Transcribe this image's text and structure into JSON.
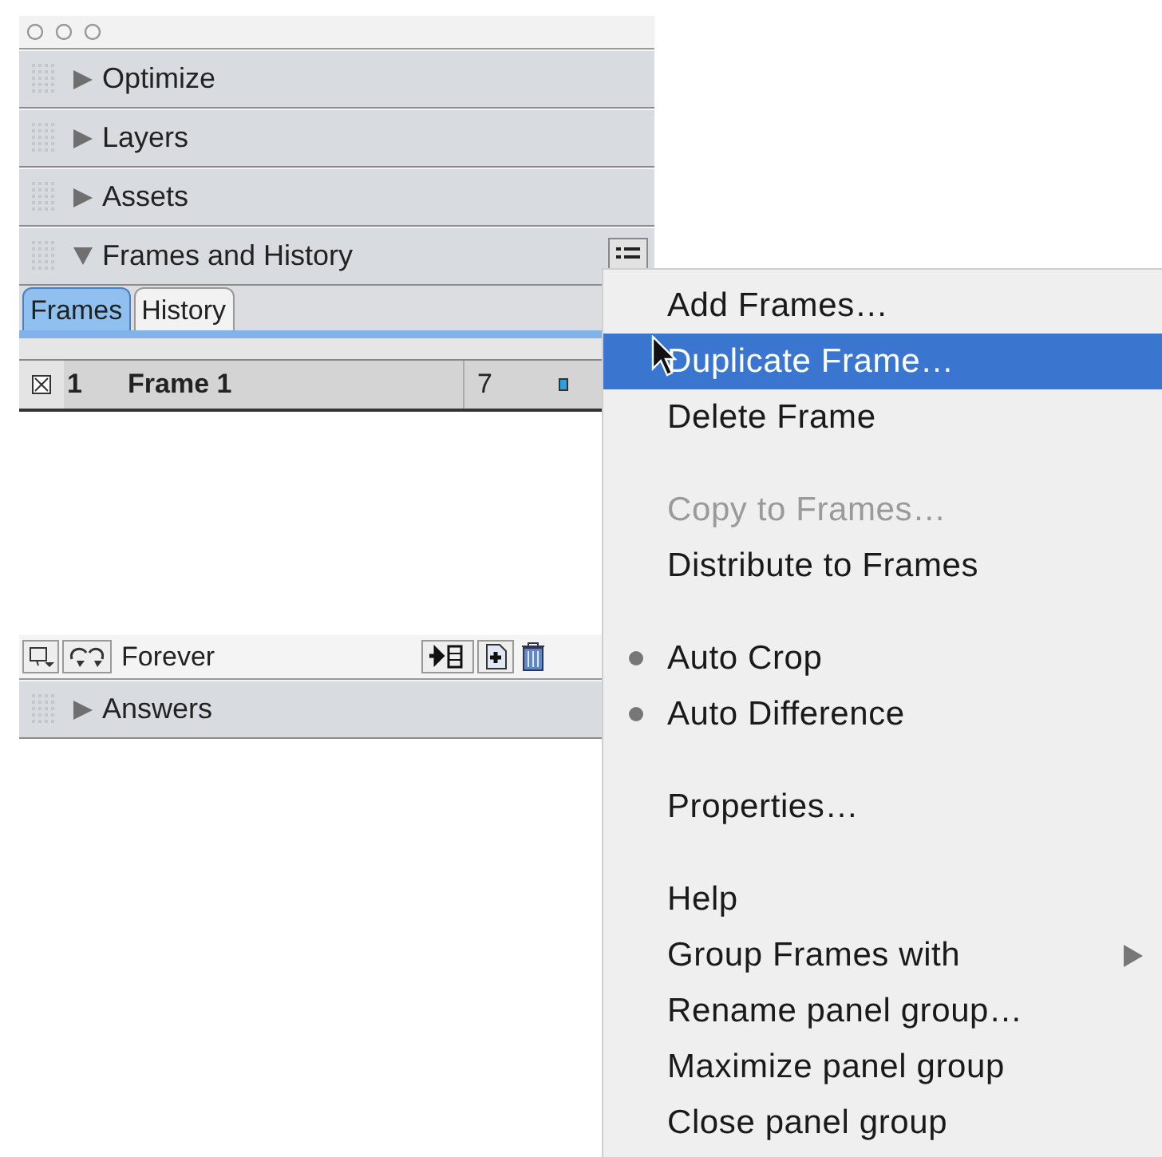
{
  "panels": [
    {
      "title": "Optimize",
      "expanded": false
    },
    {
      "title": "Layers",
      "expanded": false
    },
    {
      "title": "Assets",
      "expanded": false
    },
    {
      "title": "Frames and History",
      "expanded": true
    },
    {
      "title": "Answers",
      "expanded": false
    }
  ],
  "tabs": [
    {
      "label": "Frames",
      "selected": true
    },
    {
      "label": "History",
      "selected": false
    }
  ],
  "frames": [
    {
      "number": "1",
      "name": "Frame 1",
      "delay": "7"
    }
  ],
  "loop": "Forever",
  "menu": [
    {
      "kind": "item",
      "label": "Add Frames…",
      "selected": false,
      "disabled": false,
      "checked": false,
      "submenu": false
    },
    {
      "kind": "item",
      "label": "Duplicate Frame…",
      "selected": true,
      "disabled": false,
      "checked": false,
      "submenu": false
    },
    {
      "kind": "item",
      "label": "Delete Frame",
      "selected": false,
      "disabled": false,
      "checked": false,
      "submenu": false
    },
    {
      "kind": "separator"
    },
    {
      "kind": "item",
      "label": "Copy to Frames…",
      "selected": false,
      "disabled": true,
      "checked": false,
      "submenu": false
    },
    {
      "kind": "item",
      "label": "Distribute to Frames",
      "selected": false,
      "disabled": false,
      "checked": false,
      "submenu": false
    },
    {
      "kind": "separator"
    },
    {
      "kind": "item",
      "label": "Auto Crop",
      "selected": false,
      "disabled": false,
      "checked": true,
      "submenu": false
    },
    {
      "kind": "item",
      "label": "Auto Difference",
      "selected": false,
      "disabled": false,
      "checked": true,
      "submenu": false
    },
    {
      "kind": "separator"
    },
    {
      "kind": "item",
      "label": "Properties…",
      "selected": false,
      "disabled": false,
      "checked": false,
      "submenu": false
    },
    {
      "kind": "separator"
    },
    {
      "kind": "item",
      "label": "Help",
      "selected": false,
      "disabled": false,
      "checked": false,
      "submenu": false
    },
    {
      "kind": "item",
      "label": "Group Frames with",
      "selected": false,
      "disabled": false,
      "checked": false,
      "submenu": true
    },
    {
      "kind": "item",
      "label": "Rename panel group…",
      "selected": false,
      "disabled": false,
      "checked": false,
      "submenu": false
    },
    {
      "kind": "item",
      "label": "Maximize panel group",
      "selected": false,
      "disabled": false,
      "checked": false,
      "submenu": false
    },
    {
      "kind": "item",
      "label": "Close panel group",
      "selected": false,
      "disabled": false,
      "checked": false,
      "submenu": false
    }
  ]
}
